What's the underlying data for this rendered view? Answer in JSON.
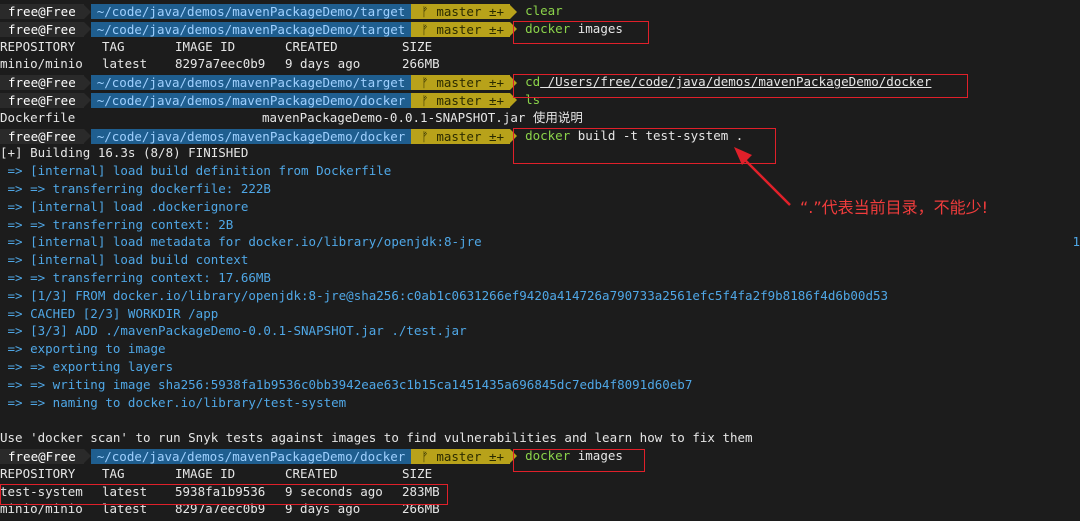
{
  "colors": {
    "user_bg": "#2a2a2a",
    "path_bg": "#1f5e8f",
    "branch_bg": "#b8a21a",
    "cmd": "#8bd34a",
    "log_blue": "#4fa7e6",
    "annotation": "#f03c3c"
  },
  "prompts": [
    {
      "user": "free@Free",
      "path": "~/code/java/demos/mavenPackageDemo/target",
      "branch": "master ±+",
      "cmd": "clear",
      "arg": ""
    },
    {
      "user": "free@Free",
      "path": "~/code/java/demos/mavenPackageDemo/target",
      "branch": "master ±+",
      "cmd": "docker",
      "arg": "images"
    },
    {
      "user": "free@Free",
      "path": "~/code/java/demos/mavenPackageDemo/target",
      "branch": "master ±+",
      "cmd": "cd",
      "arg": "/Users/free/code/java/demos/mavenPackageDemo/docker"
    },
    {
      "user": "free@Free",
      "path": "~/code/java/demos/mavenPackageDemo/docker",
      "branch": "master ±+",
      "cmd": "ls",
      "arg": ""
    },
    {
      "user": "free@Free",
      "path": "~/code/java/demos/mavenPackageDemo/docker",
      "branch": "master ±+",
      "cmd": "docker",
      "arg": "build -t test-system ."
    },
    {
      "user": "free@Free",
      "path": "~/code/java/demos/mavenPackageDemo/docker",
      "branch": "master ±+",
      "cmd": "docker",
      "arg": "images"
    }
  ],
  "images_table1": {
    "headers": [
      "REPOSITORY",
      "TAG",
      "IMAGE ID",
      "CREATED",
      "SIZE"
    ],
    "rows": [
      [
        "minio/minio",
        "latest",
        "8297a7eec0b9",
        "9 days ago",
        "266MB"
      ]
    ]
  },
  "ls_output": {
    "file1": "Dockerfile",
    "file2": "mavenPackageDemo-0.0.1-SNAPSHOT.jar 使用说明"
  },
  "build_header": "[+] Building 16.3s (8/8) FINISHED",
  "build_lines": [
    "=> [internal] load build definition from Dockerfile",
    "=> => transferring dockerfile: 222B",
    "=> [internal] load .dockerignore",
    "=> => transferring context: 2B",
    "=> [internal] load metadata for docker.io/library/openjdk:8-jre",
    "=> [internal] load build context",
    "=> => transferring context: 17.66MB",
    "=> [1/3] FROM docker.io/library/openjdk:8-jre@sha256:c0ab1c0631266ef9420a414726a790733a2561efc5f4fa2f9b8186f4d6b00d53",
    "=> CACHED [2/3] WORKDIR /app",
    "=> [3/3] ADD ./mavenPackageDemo-0.0.1-SNAPSHOT.jar ./test.jar",
    "=> exporting to image",
    "=> => exporting layers",
    "=> => writing image sha256:5938fa1b9536c0bb3942eae63c1b15ca1451435a696845dc7edb4f8091d60eb7",
    "=> => naming to docker.io/library/test-system"
  ],
  "metadata_trailing": "1",
  "scan_hint": "Use 'docker scan' to run Snyk tests against images to find vulnerabilities and learn how to fix them",
  "images_table2": {
    "headers": [
      "REPOSITORY",
      "TAG",
      "IMAGE ID",
      "CREATED",
      "SIZE"
    ],
    "rows": [
      [
        "test-system",
        "latest",
        "5938fa1b9536",
        "9 seconds ago",
        "283MB"
      ],
      [
        "minio/minio",
        "latest",
        "8297a7eec0b9",
        "9 days ago",
        "266MB"
      ]
    ]
  },
  "annotation_text": "“.”代表当前目录，不能少!"
}
